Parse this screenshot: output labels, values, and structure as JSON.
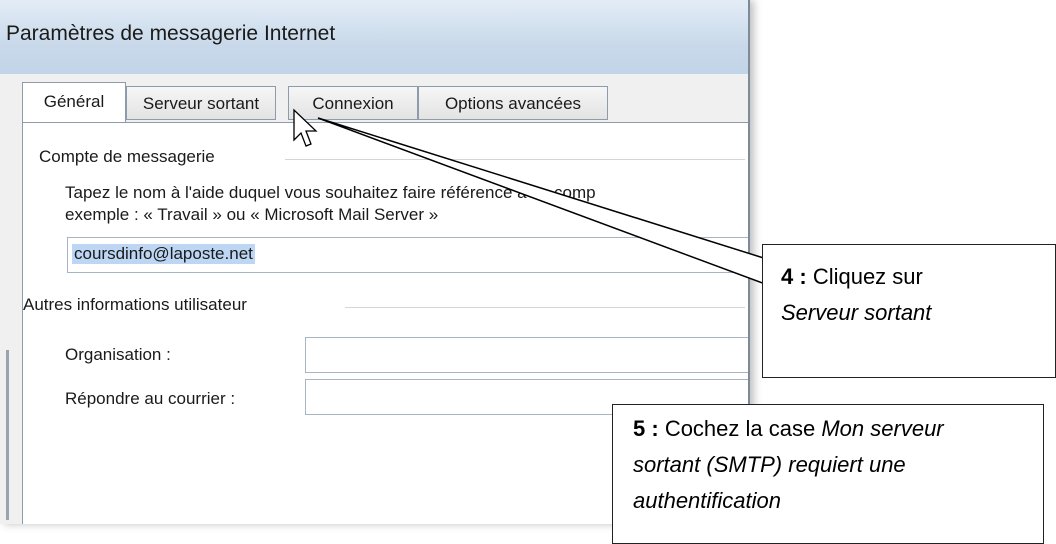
{
  "dialog": {
    "title": "Paramètres de messagerie Internet",
    "tabs": [
      {
        "label": "Général",
        "state": "active"
      },
      {
        "label": "Serveur sortant",
        "state": "hover"
      },
      {
        "label": "Connexion",
        "state": "normal"
      },
      {
        "label": "Options avancées",
        "state": "normal"
      }
    ],
    "account_group": {
      "title": "Compte de messagerie",
      "description_line1": "Tapez le nom à l'aide duquel vous souhaitez faire référence à ce comp",
      "description_line2": "exemple : « Travail » ou « Microsoft Mail Server »",
      "account_name_value": "coursdinfo@laposte.net"
    },
    "user_group": {
      "title": "Autres informations utilisateur",
      "organisation_label": "Organisation :",
      "organisation_value": "",
      "reply_label": "Répondre au courrier :",
      "reply_value": ""
    }
  },
  "callouts": {
    "step4": {
      "num": "4 :",
      "text": "Cliquez sur",
      "italic": "Serveur sortant"
    },
    "step5": {
      "num": "5 :",
      "text": "Cochez la case",
      "italic_line1": "Mon serveur",
      "italic_line2": "sortant (SMTP) requiert une",
      "italic_line3": "authentification"
    }
  },
  "colors": {
    "titlebar": "#c9d9ea",
    "selection": "#bcd6f3",
    "hover_tab": "#bfe3f7"
  }
}
